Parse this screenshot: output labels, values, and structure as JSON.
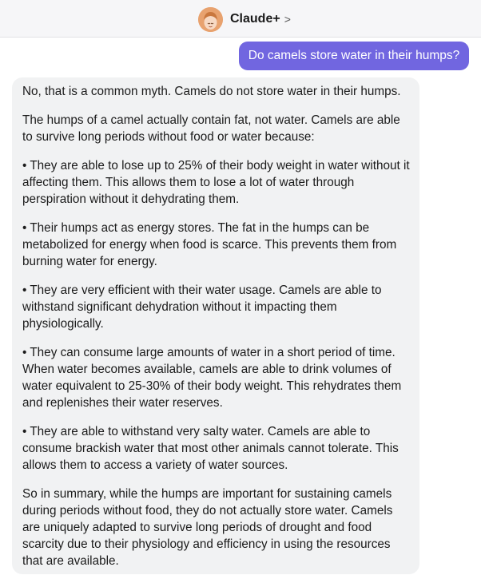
{
  "header": {
    "bot_name": "Claude+",
    "chevron": ">",
    "avatar_icon": "smiling-face-avatar",
    "colors": {
      "avatar_bg": "#e8a26f",
      "header_bg": "#f6f6f8"
    }
  },
  "conversation": {
    "user_message": "Do camels store water in their humps?",
    "user_bubble_color": "#7166e0",
    "bot_paragraphs": [
      "No, that is a common myth. Camels do not store water in their humps.",
      "The humps of a camel actually contain fat, not water. Camels are able to survive long periods without food or water because:",
      "• They are able to lose up to 25% of their body weight in water without it affecting them. This allows them to lose a lot of water through perspiration without it dehydrating them.",
      "• Their humps act as energy stores. The fat in the humps can be metabolized for energy when food is scarce. This prevents them from burning water for energy.",
      "• They are very efficient with their water usage. Camels are able to withstand significant dehydration without it impacting them physiologically.",
      "• They can consume large amounts of water in a short period of time. When water becomes available, camels are able to drink volumes of water equivalent to 25-30% of their body weight. This rehydrates them and replenishes their water reserves.",
      "• They are able to withstand very salty water. Camels are able to consume brackish water that most other animals cannot tolerate. This allows them to access a variety of water sources.",
      "So in summary, while the humps are important for sustaining camels during periods without food, they do not actually store water. Camels are uniquely adapted to survive long periods of drought and food scarcity due to their physiology and efficiency in using the resources that are available."
    ]
  }
}
